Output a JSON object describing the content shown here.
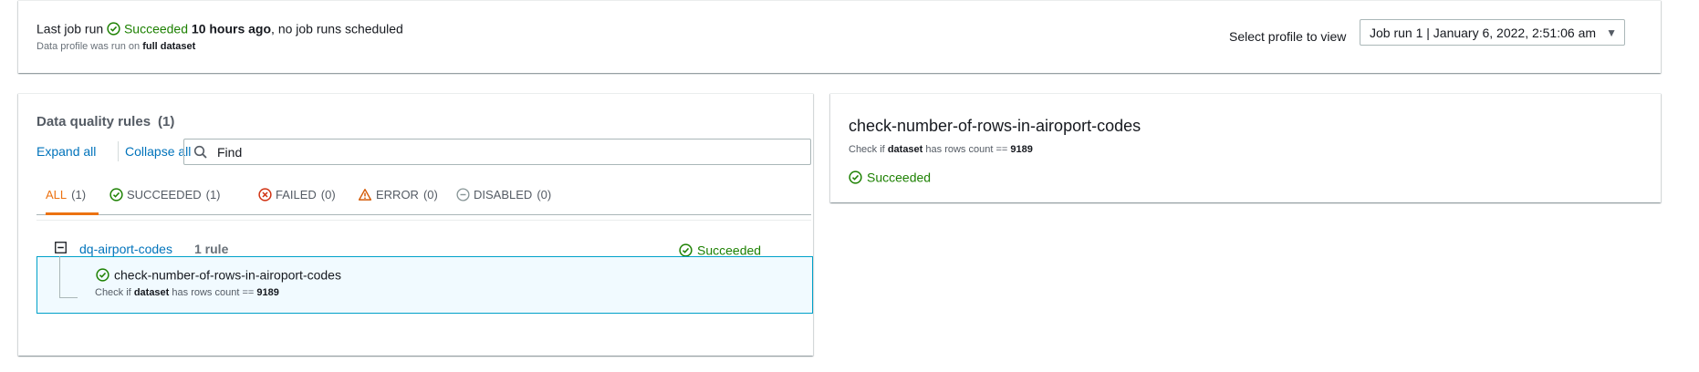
{
  "header": {
    "last_job_run_label": "Last job run",
    "status": "Succeeded",
    "time_ago": "10 hours ago",
    "schedule_text": ", no job runs scheduled",
    "dataset_prefix": "Data profile was run on",
    "dataset_value": "full dataset",
    "profile_label": "Select profile to view",
    "profile_selected": "Job run 1 | January 6, 2022, 2:51:06 am"
  },
  "rules_panel": {
    "title": "Data quality rules",
    "count": "(1)",
    "expand_all": "Expand all",
    "collapse_all": "Collapse all",
    "search_value": "Find",
    "tabs": [
      {
        "label": "ALL",
        "count": "(1)"
      },
      {
        "label": "SUCCEEDED",
        "count": "(1)"
      },
      {
        "label": "FAILED",
        "count": "(0)"
      },
      {
        "label": "ERROR",
        "count": "(0)"
      },
      {
        "label": "DISABLED",
        "count": "(0)"
      }
    ],
    "group": {
      "name": "dq-airport-codes",
      "rule_count": "1 rule",
      "status": "Succeeded",
      "rule": {
        "name": "check-number-of-rows-in-airoport-codes",
        "desc_prefix": "Check if",
        "desc_subject": "dataset",
        "desc_middle": "has rows count ==",
        "desc_value": "9189"
      }
    }
  },
  "detail_panel": {
    "title": "check-number-of-rows-in-airoport-codes",
    "desc_prefix": "Check if",
    "desc_subject": "dataset",
    "desc_middle": "has rows count ==",
    "desc_value": "9189",
    "status": "Succeeded"
  },
  "colors": {
    "success": "#1d8102",
    "link": "#0073bb",
    "active_tab": "#ec7211",
    "error": "#d13212",
    "warning": "#ff9900",
    "selected_row_bg": "#f1faff",
    "selected_row_border": "#00a1c9"
  },
  "icons": {
    "status": "check-circle-icon",
    "search": "search-icon",
    "failed": "x-circle-icon",
    "error": "warning-triangle-icon",
    "disabled": "minus-circle-icon",
    "collapse": "minus-square-icon",
    "dropdown": "caret-down-icon"
  }
}
